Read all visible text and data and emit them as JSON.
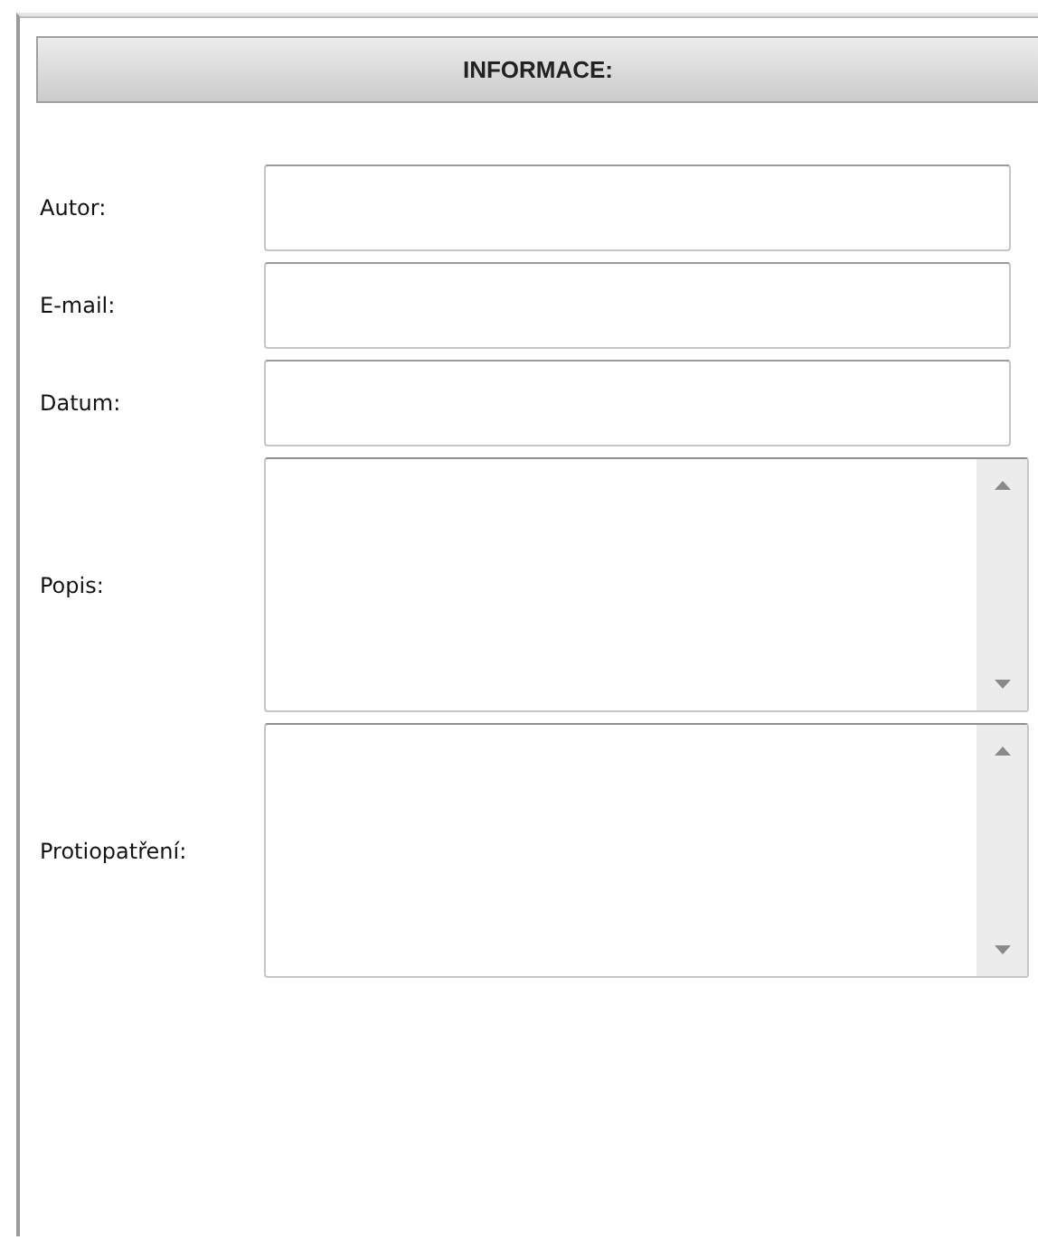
{
  "panel": {
    "title": "INFORMACE:"
  },
  "fields": [
    {
      "label": "Autor:",
      "kind": "input"
    },
    {
      "label": "E-mail:",
      "kind": "input"
    },
    {
      "label": "Datum:",
      "kind": "input"
    },
    {
      "label": "Popis:",
      "kind": "textarea"
    },
    {
      "label": "Protiopatření:",
      "kind": "textarea"
    }
  ]
}
